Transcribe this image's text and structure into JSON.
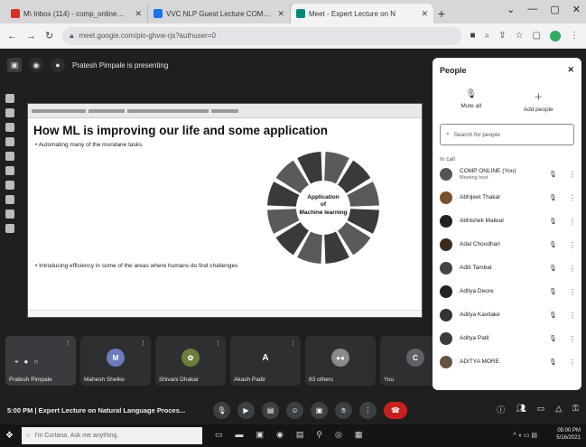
{
  "browser": {
    "tabs": [
      {
        "title": "M\\ Inbox (114) - comp_online@mu",
        "favicon_color": "#d93025",
        "active": false
      },
      {
        "title": "VVC NLP Guest Lecture COMP A",
        "favicon_color": "#1a73e8",
        "active": false
      },
      {
        "title": "Meet - Expert Lecture on N",
        "favicon_color": "#00897b",
        "active": true
      }
    ],
    "new_tab": "+",
    "url": "meet.google.com/pio-ghvw-rjs?authuser=0",
    "window_controls": [
      "⌄",
      "—",
      "▢",
      "✕"
    ]
  },
  "meet": {
    "presenting_text": "Pratesh Pimpale is presenting",
    "slide": {
      "title": "How ML is improving our life and some application",
      "bullet_1": "• Automating many of the mundane tasks",
      "bullet_2": "• Introducing efficiency in some of the areas where humans do find challenges",
      "wheel_center_line1": "Application",
      "wheel_center_line2": "of",
      "wheel_center_line3": "Machine learning"
    },
    "tiles": [
      {
        "name": "Pratesh Pimpale",
        "initial": "",
        "color": "#3a3b3e"
      },
      {
        "name": "Mahesh Shelke",
        "initial": "M",
        "color": "#6d7bbd"
      },
      {
        "name": "Shivani Dhakar",
        "initial": "",
        "color": "#6b7d3a"
      },
      {
        "name": "Akash Padir",
        "initial": "A",
        "color": "#3a3b3e"
      },
      {
        "name": "83 others",
        "initial": "",
        "color": "#3a3b3e"
      },
      {
        "name": "You",
        "initial": "C",
        "color": "#5f6368"
      }
    ],
    "meeting_info": "5:00 PM  |  Expert Lecture on Natural Language Proces..."
  },
  "people": {
    "title": "People",
    "mute_all": "Mute all",
    "add_people": "Add people",
    "search_placeholder": "Search for people",
    "in_call_label": "In call",
    "participants": [
      {
        "name": "COMP ONLINE (You)",
        "sub": "Meeting host",
        "color": "#555"
      },
      {
        "name": "Abhijeet Thakar",
        "sub": "",
        "color": "#7a5230"
      },
      {
        "name": "Abhishek Malwal",
        "sub": "",
        "color": "#222"
      },
      {
        "name": "Adal Choudhari",
        "sub": "",
        "color": "#3b2a1e"
      },
      {
        "name": "Aditi Tambat",
        "sub": "",
        "color": "#444"
      },
      {
        "name": "Aditya Deore",
        "sub": "",
        "color": "#222"
      },
      {
        "name": "Aditya Kavitake",
        "sub": "",
        "color": "#333"
      },
      {
        "name": "Aditya Patil",
        "sub": "",
        "color": "#3a3a3a"
      },
      {
        "name": "ADITYA MORE",
        "sub": "",
        "color": "#654"
      }
    ]
  },
  "taskbar": {
    "search_placeholder": "I'm Cortana. Ask me anything.",
    "time": "05:00 PM",
    "date": "5/16/2021"
  }
}
